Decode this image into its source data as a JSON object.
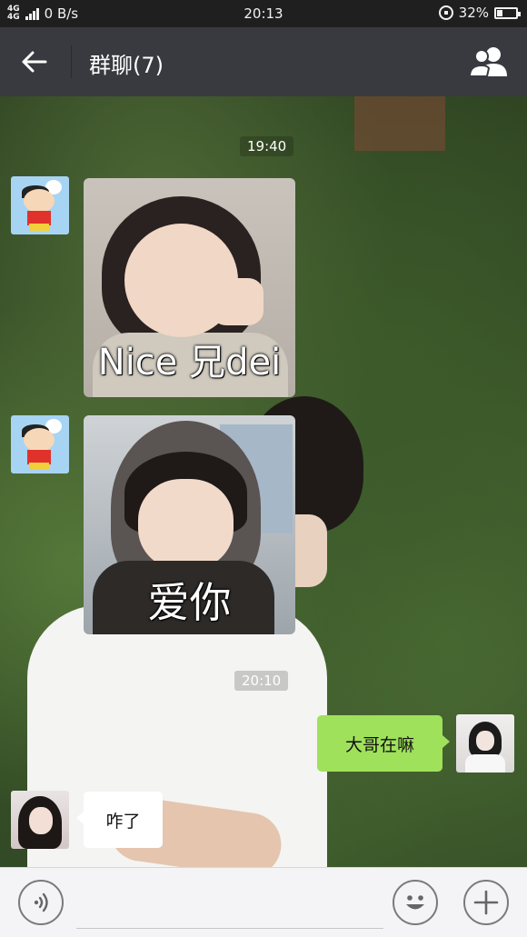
{
  "status_bar": {
    "network_type": "4G",
    "network_type_2": "4G",
    "data_speed": "0 B/s",
    "time": "20:13",
    "battery_percent": "32%",
    "battery_level": 0.32,
    "icons": [
      "signal-icon",
      "rotation-lock-icon",
      "battery-icon"
    ]
  },
  "header": {
    "title": "群聊(7)",
    "back_icon": "back-arrow-icon",
    "members_icon": "group-members-icon"
  },
  "messages": [
    {
      "type": "timestamp",
      "text": "19:40"
    },
    {
      "type": "sticker",
      "direction": "incoming",
      "sender_avatar": "crayon-shin-chan-avatar",
      "caption": "Nice 兄dei"
    },
    {
      "type": "sticker",
      "direction": "incoming",
      "sender_avatar": "crayon-shin-chan-avatar",
      "caption": "爱你"
    },
    {
      "type": "timestamp",
      "text": "20:10"
    },
    {
      "type": "text",
      "direction": "outgoing",
      "sender_avatar": "hooded-user-avatar",
      "text": "大哥在嘛"
    },
    {
      "type": "text",
      "direction": "incoming",
      "sender_avatar": "girl-avatar",
      "text": "咋了"
    }
  ],
  "input_bar": {
    "voice_icon": "voice-input-icon",
    "value": "",
    "emoji_icon": "emoji-icon",
    "more_icon": "plus-icon"
  },
  "colors": {
    "status_bar_bg": "#1f1f1f",
    "header_bg": "#393a3f",
    "outgoing_bubble": "#9fe15b",
    "incoming_bubble": "#ffffff",
    "input_bar_bg": "#f4f4f6"
  }
}
